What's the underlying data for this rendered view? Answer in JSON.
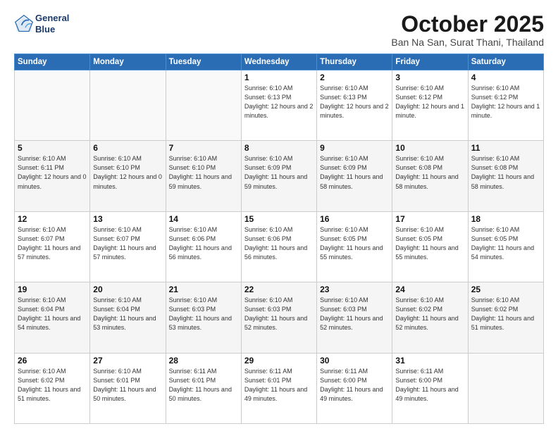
{
  "header": {
    "logo_line1": "General",
    "logo_line2": "Blue",
    "month_title": "October 2025",
    "location": "Ban Na San, Surat Thani, Thailand"
  },
  "weekdays": [
    "Sunday",
    "Monday",
    "Tuesday",
    "Wednesday",
    "Thursday",
    "Friday",
    "Saturday"
  ],
  "weeks": [
    [
      {
        "day": "",
        "info": ""
      },
      {
        "day": "",
        "info": ""
      },
      {
        "day": "",
        "info": ""
      },
      {
        "day": "1",
        "info": "Sunrise: 6:10 AM\nSunset: 6:13 PM\nDaylight: 12 hours\nand 2 minutes."
      },
      {
        "day": "2",
        "info": "Sunrise: 6:10 AM\nSunset: 6:13 PM\nDaylight: 12 hours\nand 2 minutes."
      },
      {
        "day": "3",
        "info": "Sunrise: 6:10 AM\nSunset: 6:12 PM\nDaylight: 12 hours\nand 1 minute."
      },
      {
        "day": "4",
        "info": "Sunrise: 6:10 AM\nSunset: 6:12 PM\nDaylight: 12 hours\nand 1 minute."
      }
    ],
    [
      {
        "day": "5",
        "info": "Sunrise: 6:10 AM\nSunset: 6:11 PM\nDaylight: 12 hours\nand 0 minutes."
      },
      {
        "day": "6",
        "info": "Sunrise: 6:10 AM\nSunset: 6:10 PM\nDaylight: 12 hours\nand 0 minutes."
      },
      {
        "day": "7",
        "info": "Sunrise: 6:10 AM\nSunset: 6:10 PM\nDaylight: 11 hours\nand 59 minutes."
      },
      {
        "day": "8",
        "info": "Sunrise: 6:10 AM\nSunset: 6:09 PM\nDaylight: 11 hours\nand 59 minutes."
      },
      {
        "day": "9",
        "info": "Sunrise: 6:10 AM\nSunset: 6:09 PM\nDaylight: 11 hours\nand 58 minutes."
      },
      {
        "day": "10",
        "info": "Sunrise: 6:10 AM\nSunset: 6:08 PM\nDaylight: 11 hours\nand 58 minutes."
      },
      {
        "day": "11",
        "info": "Sunrise: 6:10 AM\nSunset: 6:08 PM\nDaylight: 11 hours\nand 58 minutes."
      }
    ],
    [
      {
        "day": "12",
        "info": "Sunrise: 6:10 AM\nSunset: 6:07 PM\nDaylight: 11 hours\nand 57 minutes."
      },
      {
        "day": "13",
        "info": "Sunrise: 6:10 AM\nSunset: 6:07 PM\nDaylight: 11 hours\nand 57 minutes."
      },
      {
        "day": "14",
        "info": "Sunrise: 6:10 AM\nSunset: 6:06 PM\nDaylight: 11 hours\nand 56 minutes."
      },
      {
        "day": "15",
        "info": "Sunrise: 6:10 AM\nSunset: 6:06 PM\nDaylight: 11 hours\nand 56 minutes."
      },
      {
        "day": "16",
        "info": "Sunrise: 6:10 AM\nSunset: 6:05 PM\nDaylight: 11 hours\nand 55 minutes."
      },
      {
        "day": "17",
        "info": "Sunrise: 6:10 AM\nSunset: 6:05 PM\nDaylight: 11 hours\nand 55 minutes."
      },
      {
        "day": "18",
        "info": "Sunrise: 6:10 AM\nSunset: 6:05 PM\nDaylight: 11 hours\nand 54 minutes."
      }
    ],
    [
      {
        "day": "19",
        "info": "Sunrise: 6:10 AM\nSunset: 6:04 PM\nDaylight: 11 hours\nand 54 minutes."
      },
      {
        "day": "20",
        "info": "Sunrise: 6:10 AM\nSunset: 6:04 PM\nDaylight: 11 hours\nand 53 minutes."
      },
      {
        "day": "21",
        "info": "Sunrise: 6:10 AM\nSunset: 6:03 PM\nDaylight: 11 hours\nand 53 minutes."
      },
      {
        "day": "22",
        "info": "Sunrise: 6:10 AM\nSunset: 6:03 PM\nDaylight: 11 hours\nand 52 minutes."
      },
      {
        "day": "23",
        "info": "Sunrise: 6:10 AM\nSunset: 6:03 PM\nDaylight: 11 hours\nand 52 minutes."
      },
      {
        "day": "24",
        "info": "Sunrise: 6:10 AM\nSunset: 6:02 PM\nDaylight: 11 hours\nand 52 minutes."
      },
      {
        "day": "25",
        "info": "Sunrise: 6:10 AM\nSunset: 6:02 PM\nDaylight: 11 hours\nand 51 minutes."
      }
    ],
    [
      {
        "day": "26",
        "info": "Sunrise: 6:10 AM\nSunset: 6:02 PM\nDaylight: 11 hours\nand 51 minutes."
      },
      {
        "day": "27",
        "info": "Sunrise: 6:10 AM\nSunset: 6:01 PM\nDaylight: 11 hours\nand 50 minutes."
      },
      {
        "day": "28",
        "info": "Sunrise: 6:11 AM\nSunset: 6:01 PM\nDaylight: 11 hours\nand 50 minutes."
      },
      {
        "day": "29",
        "info": "Sunrise: 6:11 AM\nSunset: 6:01 PM\nDaylight: 11 hours\nand 49 minutes."
      },
      {
        "day": "30",
        "info": "Sunrise: 6:11 AM\nSunset: 6:00 PM\nDaylight: 11 hours\nand 49 minutes."
      },
      {
        "day": "31",
        "info": "Sunrise: 6:11 AM\nSunset: 6:00 PM\nDaylight: 11 hours\nand 49 minutes."
      },
      {
        "day": "",
        "info": ""
      }
    ]
  ]
}
